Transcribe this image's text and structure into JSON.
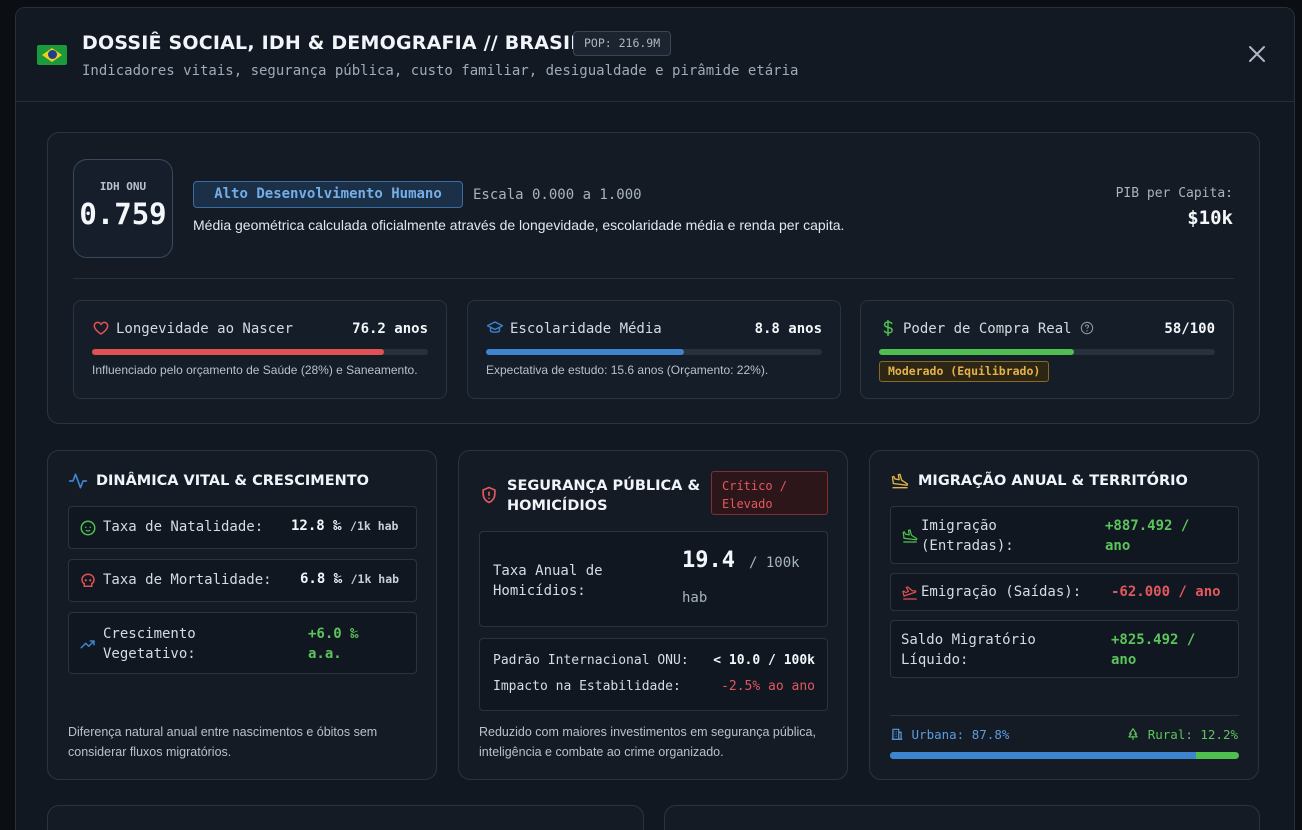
{
  "header": {
    "title": "DOSSIÊ SOCIAL, IDH & DEMOGRAFIA // BRASIL",
    "pop_badge": "POP: 216.9M",
    "subtitle": "Indicadores vitais, segurança pública, custo familiar, desigualdade e pirâmide etária",
    "close_label": "×"
  },
  "idh": {
    "label": "IDH ONU",
    "value": "0.759",
    "classification": "Alto Desenvolvimento Humano",
    "scale": "Escala 0.000 a 1.000",
    "description": "Média geométrica calculada oficialmente através de longevidade, escolaridade média e renda per capita.",
    "pib_label": "PIB per Capita:",
    "pib_value": "$10k"
  },
  "metrics": [
    {
      "name": "Longevidade ao Nascer",
      "value": "76.2 anos",
      "fill": 0.87,
      "color": "#e05252",
      "note": "Influenciado pelo orçamento de Saúde (28%) e Saneamento.",
      "icon": "heart-icon"
    },
    {
      "name": "Escolaridade Média",
      "value": "8.8 anos",
      "fill": 0.59,
      "color": "#3d85cf",
      "note": "Expectativa de estudo: 15.6 anos (Orçamento: 22%).",
      "icon": "graduation-cap-icon"
    },
    {
      "name": "Poder de Compra Real",
      "value": "58/100",
      "fill": 0.58,
      "color": "#4fbf4f",
      "badge": "Moderado (Equilibrado)",
      "icon": "dollar-icon"
    }
  ],
  "vital": {
    "title": "DINÂMICA VITAL & CRESCIMENTO",
    "natalidade_label": "Taxa de Natalidade:",
    "natalidade_value": "12.8 ‰",
    "natalidade_unit": "/1k hab",
    "mortalidade_label": "Taxa de Mortalidade:",
    "mortalidade_value": "6.8 ‰",
    "mortalidade_unit": "/1k hab",
    "crescimento_label_1": "Crescimento",
    "crescimento_label_2": "Vegetativo:",
    "crescimento_value_1": "+6.0 ‰",
    "crescimento_value_2": "a.a.",
    "note": "Diferença natural anual entre nascimentos e óbitos sem considerar fluxos migratórios."
  },
  "security": {
    "title_1": "SEGURANÇA PÚBLICA &",
    "title_2": "HOMICÍDIOS",
    "status_1": "Crítico /",
    "status_2": "Elevado",
    "rate_label_1": "Taxa Anual de",
    "rate_label_2": "Homicídios:",
    "rate_value": "19.4",
    "rate_unit_1": "/ 100k",
    "rate_unit_2": "hab",
    "standard_label": "Padrão Internacional ONU:",
    "standard_value": "< 10.0 / 100k",
    "impact_label": "Impacto na Estabilidade:",
    "impact_value": "-2.5% ao ano",
    "note": "Reduzido com maiores investimentos em segurança pública, inteligência e combate ao crime organizado."
  },
  "migration": {
    "title": "MIGRAÇÃO ANUAL & TERRITÓRIO",
    "imm_label_1": "Imigração",
    "imm_label_2": "(Entradas):",
    "imm_value_1": "+887.492 /",
    "imm_value_2": "ano",
    "emi_label": "Emigração (Saídas):",
    "emi_value": "-62.000 / ano",
    "saldo_label_1": "Saldo Migratório",
    "saldo_label_2": "Líquido:",
    "saldo_value_1": "+825.492 /",
    "saldo_value_2": "ano",
    "urban_label": "Urbana: 87.8%",
    "rural_label": "Rural: 12.2%",
    "urban_fraction": 0.878
  },
  "colors": {
    "positive": "#5cc45c",
    "negative": "#e2585f",
    "accent": "#3d85cf",
    "warning": "#e3b34a"
  }
}
